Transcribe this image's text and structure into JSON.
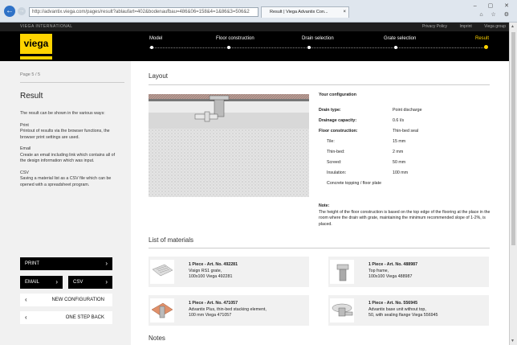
{
  "browser": {
    "url": "http://advantix.viega.com/pages/result?ablaufart=402&bodenaufbau=486&06=158&4=1&86&3=506&2",
    "tab_title": "Result | Viega Advantix Con...",
    "tab_close": "×",
    "back": "←",
    "forward": "→",
    "window_controls": "– ▢ ✕",
    "tools": "⌂ ☆ ⚙"
  },
  "site": {
    "brand_small": "VIEGA INTERNATIONAL",
    "top_links": [
      "Privacy Policy",
      "Imprint",
      "Viega group"
    ],
    "logo": "viega",
    "steps": [
      {
        "label": "Model",
        "active": false
      },
      {
        "label": "Floor construction",
        "active": false
      },
      {
        "label": "Drain selection",
        "active": false
      },
      {
        "label": "Grate selection",
        "active": false
      },
      {
        "label": "Result",
        "active": true
      }
    ],
    "accent": "#ffd400"
  },
  "left": {
    "page": "Page 5 / 5",
    "title": "Result",
    "intro": "The result can be shown in the various ways:",
    "print_h": "Print",
    "print_t": "Printout of results via the browser functions, the browser print settings are used.",
    "email_h": "Email",
    "email_t": "Create an email including link which contains all of the design information which was input.",
    "csv_h": "CSV",
    "csv_t": "Saving a material list as a CSV file which can be opened with a spreadsheet program.",
    "btn_print": "PRINT",
    "btn_email": "EMAIL",
    "btn_csv": "CSV",
    "btn_new": "NEW CONFIGURATION",
    "btn_back": "ONE STEP BACK"
  },
  "main": {
    "layout_title": "Layout",
    "config_title": "Your configuration",
    "drain_type_k": "Drain type:",
    "drain_type_v": "Point discharge",
    "drainage_k": "Drainage capacity:",
    "drainage_v": "0.6 l/s",
    "floor_k": "Floor construction:",
    "floor_v": "Thin-bed seal",
    "tile_k": "Tile:",
    "tile_v": "15 mm",
    "thinbed_k": "Thin-bed:",
    "thinbed_v": "2 mm",
    "screed_k": "Screed:",
    "screed_v": "50 mm",
    "insulation_k": "Insulation:",
    "insulation_v": "100 mm",
    "concrete": "Concrete topping / floor plate",
    "note_h": "Note:",
    "note_t": "The height of the floor construction is based on the top edge of the flooring at the place in the room where the drain with grate, maintaining the minimum recommended slope of 1-2%, is placed.",
    "materials_title": "List of materials",
    "materials": [
      {
        "art": "1 Piece - Art. No. 492281",
        "l1": "Visign RS1 grate,",
        "l2": "100x100 Viega 492281"
      },
      {
        "art": "1 Piece - Art. No. 488987",
        "l1": "Top frame,",
        "l2": "100x100 Viega 488987"
      },
      {
        "art": "1 Piece - Art. No. 471057",
        "l1": "Advantix Plus, thin-bed stacking element,",
        "l2": "100 mm Viega 471057"
      },
      {
        "art": "1 Piece - Art. No. 556945",
        "l1": "Advantix base unit without top,",
        "l2": "50, with sealing flange Viega 556945"
      }
    ],
    "notes_title": "Notes"
  }
}
